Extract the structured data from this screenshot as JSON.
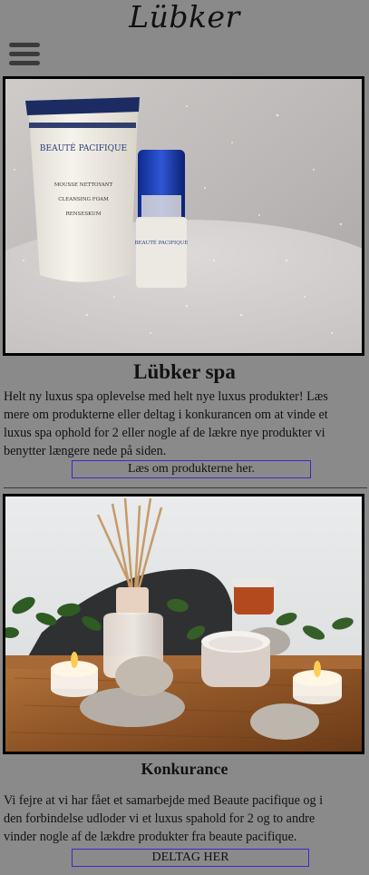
{
  "header": {
    "logo": "Lübker",
    "menu_icon": "hamburger-menu-icon"
  },
  "spa_section": {
    "image_description_icon": "product-photo",
    "product_labels": {
      "brand": "BEAUTÉ PACIFIQUE",
      "line1": "MOUSSE NETTOYANT",
      "line2": "CLEANSING FOAM",
      "line3": "RENSESKUM",
      "small_brand": "BEAUTÉ PACIFIQUE"
    },
    "title": "Lübker spa",
    "paragraph_lines": [
      "Helt ny luxus spa oplevelse med helt nye luxus produkter! Læs",
      "mere om produkterne eller deltag i konkurancen om at vinde et",
      "luxus spa ophold for 2 eller nogle af de lækre nye produkter vi",
      "benytter længere nede på siden."
    ],
    "button_label": "Læs om produkterne her."
  },
  "contest_section": {
    "title": "Konkurance",
    "paragraph_lines": [
      "Vi fejre at vi har fået et samarbejde med Beaute pacifique og i",
      "den forbindelse udloder vi et luxus spahold for 2 og to andre",
      "vinder nogle af de lækdre produkter fra beaute pacifique."
    ],
    "button_label": "DELTAG HER"
  },
  "colors": {
    "background": "#8a8a8a",
    "button_border": "#3a2ac8",
    "photo_border": "#000000"
  }
}
